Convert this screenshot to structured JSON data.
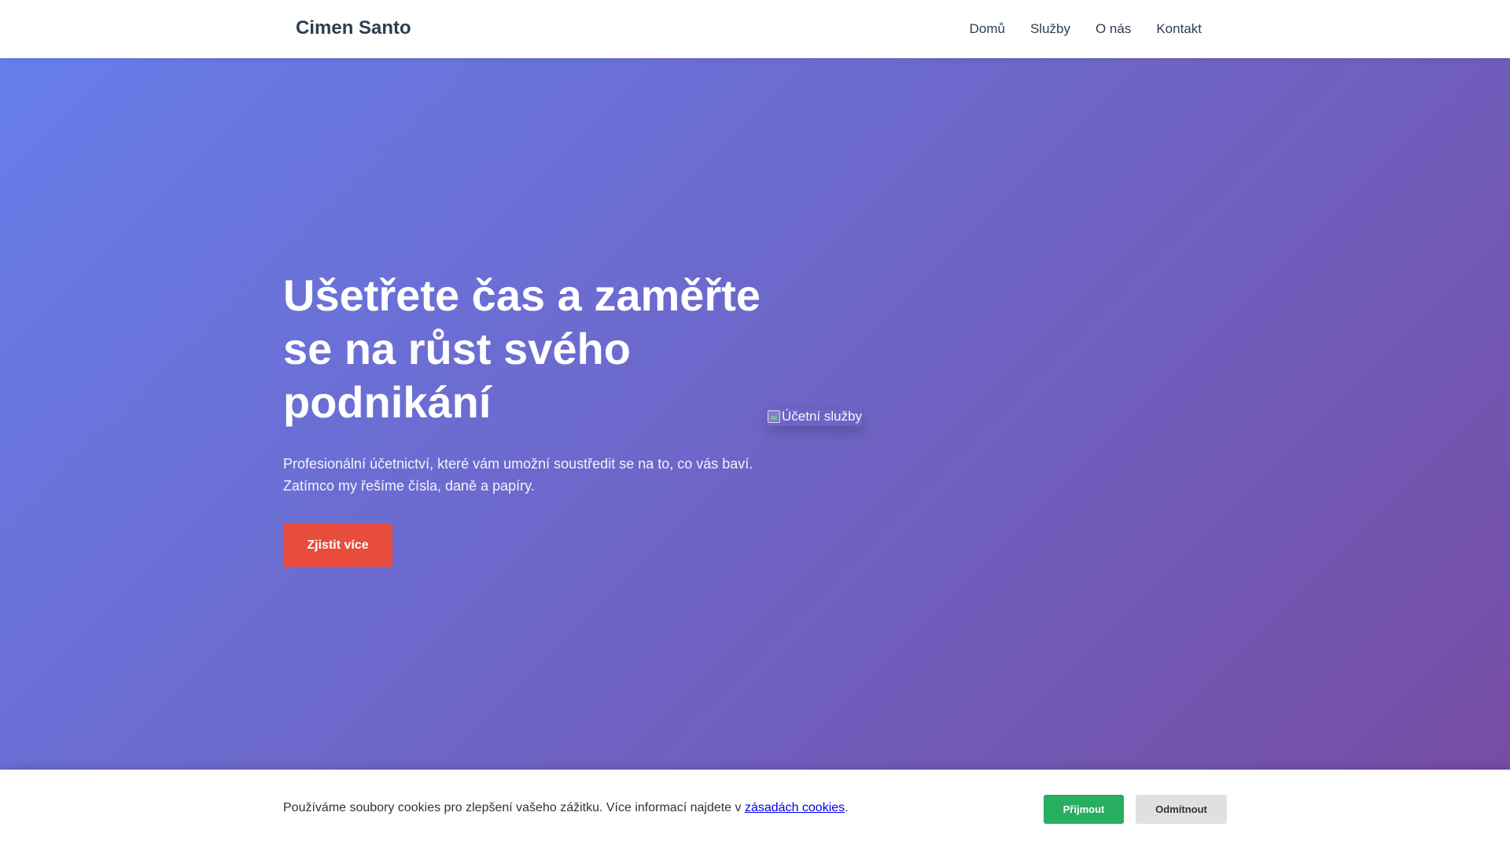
{
  "header": {
    "logo": "Cimen Santo",
    "nav": [
      "Domů",
      "Služby",
      "O nás",
      "Kontakt"
    ]
  },
  "hero": {
    "title": "Ušetřete čas a zaměřte se na růst svého podnikání",
    "subtitle": "Profesionální účetnictví, které vám umožní soustředit se na to, co vás baví. Zatímco my řešíme čísla, daně a papíry.",
    "cta_label": "Zjistit více",
    "image_alt": "Účetní služby"
  },
  "cookie": {
    "text": "Používáme soubory cookies pro zlepšení vašeho zážitku. Více informací najdete v ",
    "link_label": "zásadách cookies",
    "text_end": ".",
    "accept_label": "Přijmout",
    "decline_label": "Odmítnout"
  },
  "colors": {
    "gradient_start": "#667eea",
    "gradient_end": "#764ba2",
    "cta": "#e74c3c",
    "accept": "#27ae60",
    "decline": "#e0e0e0",
    "logo": "#2c3e50"
  }
}
